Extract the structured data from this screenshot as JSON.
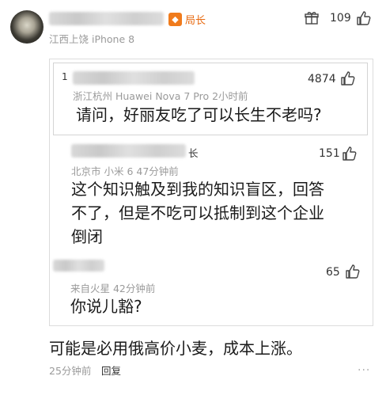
{
  "header": {
    "badge_label": "局长",
    "device": "江西上饶  iPhone 8",
    "like_count": "109"
  },
  "quotes": [
    {
      "index": "1",
      "meta": "浙江杭州  Huawei Nova 7 Pro  2小时前",
      "text": "请问，好丽友吃了可以长生不老吗?",
      "likes": "4874"
    },
    {
      "username_suffix": "长",
      "meta": "北京市  小米 6  47分钟前",
      "text_lines": [
        "这个知识触及到我的知识盲区，回答",
        "不了，但是不吃可以抵制到这个企业",
        "倒闭"
      ],
      "likes": "151"
    },
    {
      "meta": "来自火星  42分钟前",
      "text": "你说儿豁?",
      "likes": "65"
    }
  ],
  "comment": {
    "text": "可能是必用俄高价小麦，成本上涨。",
    "time": "25分钟前",
    "reply_label": "回复",
    "more": "···"
  }
}
